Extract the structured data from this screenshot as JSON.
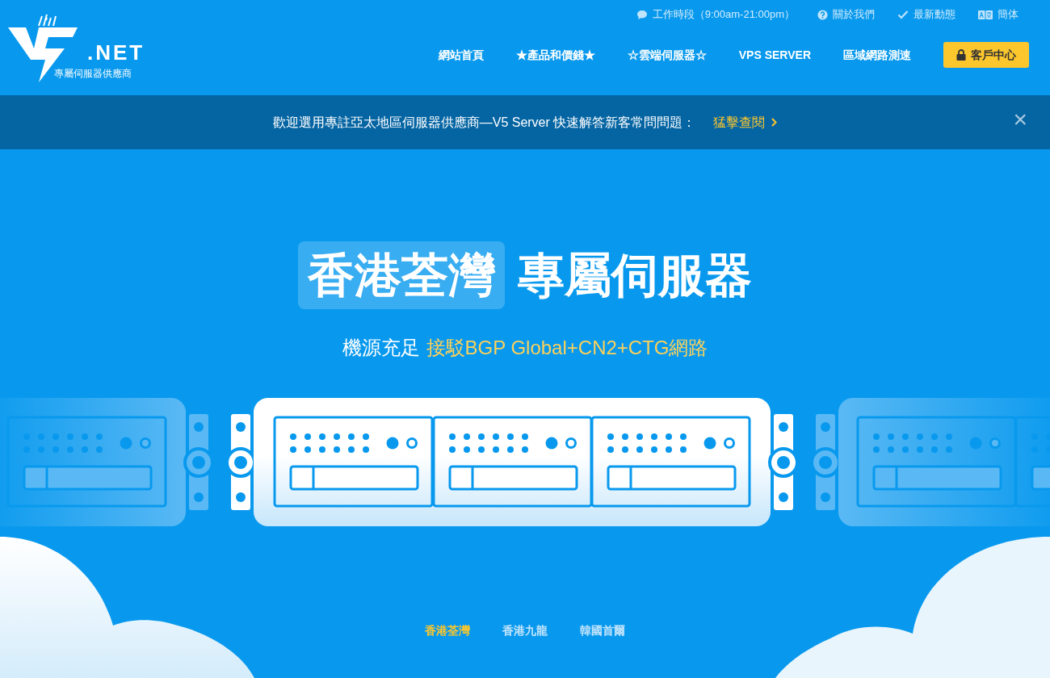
{
  "logo": {
    "suffix": ".NET",
    "tagline": "專屬伺服器供應商"
  },
  "top_links": [
    {
      "kind": "chat",
      "label": "工作時段（9:00am-21:00pm）"
    },
    {
      "kind": "help",
      "label": "關於我們"
    },
    {
      "kind": "check",
      "label": "最新動態"
    },
    {
      "kind": "translate",
      "label": "簡体"
    }
  ],
  "nav": [
    "網站首頁",
    "★產品和價錢★",
    "☆雲端伺服器☆",
    "VPS SERVER",
    "區域網路測速"
  ],
  "client_button": "客戶中心",
  "notice": {
    "text": "歡迎選用專註亞太地區伺服器供應商—V5 Server 快速解答新客常問問題：",
    "link": "猛擊查閱",
    "close": "×"
  },
  "hero": {
    "title_highlight": "香港荃灣",
    "title": "專屬伺服器",
    "subtitle": "機源充足",
    "subtitle_highlight": "接駁BGP Global+CN2+CTG網路"
  },
  "location_tabs": [
    {
      "label": "香港荃灣",
      "selected": true
    },
    {
      "label": "香港九龍",
      "selected": false
    },
    {
      "label": "韓國首爾",
      "selected": false
    }
  ]
}
